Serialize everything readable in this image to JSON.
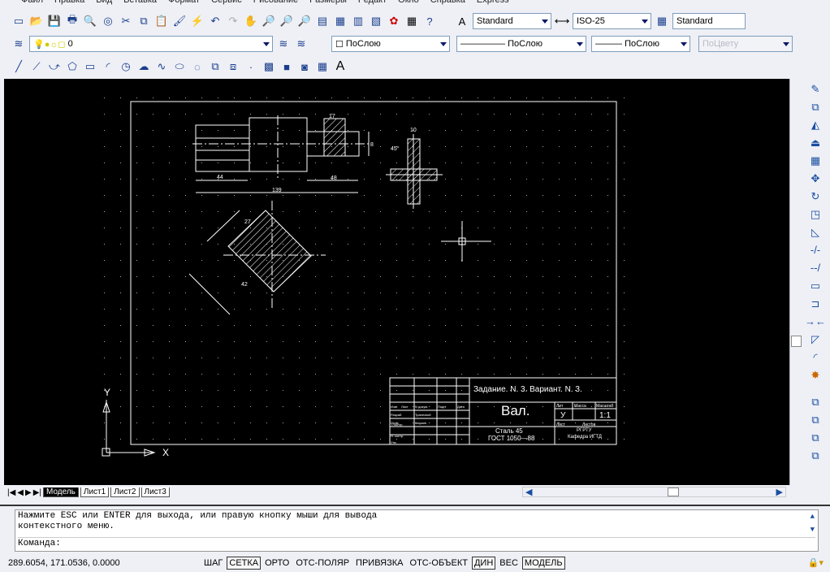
{
  "menu": [
    "Файл",
    "Правка",
    "Вид",
    "Вставка",
    "Формат",
    "Сервис",
    "Рисование",
    "Размеры",
    "Редакт",
    "Окно",
    "Справка",
    "Express"
  ],
  "styles": {
    "text_style": "Standard",
    "dim_style": "ISO-25",
    "table_style": "Standard"
  },
  "layers": {
    "current": "0",
    "color": "ПоСлою",
    "linetype": "ПоСлою",
    "lineweight": "ПоСлою",
    "plotstyle": "ПоЦвету"
  },
  "drawing": {
    "dims": [
      "44",
      "139",
      "48",
      "17",
      "8",
      "10",
      "45°",
      "27",
      "42"
    ],
    "title_block": {
      "task": "Задание. N. 3. Вариант. N. 3.",
      "name": "Вал.",
      "material": "Сталь 45",
      "standard": "ГОСТ  1050—88",
      "lit_label": "Лит",
      "mass_label": "Масса",
      "scale_label": "Масштаб",
      "lit": "У",
      "scale": "1:1",
      "sheet_label": "Лист",
      "sheets_label": "Листов",
      "org1": "РГРТУ",
      "org2": "Кафедра  ИГТД",
      "rows": [
        "Изм.",
        "Лист",
        "N докум.",
        "Подп.",
        "Дата",
        "Разраб.",
        "Трапезной",
        "Пров.",
        "Маркин",
        "Т. контр",
        "Н. контр.",
        "Утв."
      ]
    },
    "ucs": {
      "x": "X",
      "y": "Y"
    }
  },
  "tabs": [
    "Модель",
    "Лист1",
    "Лист2",
    "Лист3"
  ],
  "active_tab": "Модель",
  "command": {
    "line1": "Нажмите ESC или ENTER для выхода, или правую кнопку мыши для вывода",
    "line2": "контекстного меню.",
    "prompt": "Команда:"
  },
  "status": {
    "coords": "289.6054, 171.0536, 0.0000",
    "buttons": [
      {
        "label": "ШАГ",
        "on": false
      },
      {
        "label": "СЕТКА",
        "on": true
      },
      {
        "label": "ОРТО",
        "on": false
      },
      {
        "label": "ОТС-ПОЛЯР",
        "on": false
      },
      {
        "label": "ПРИВЯЗКА",
        "on": false
      },
      {
        "label": "ОТС-ОБЪЕКТ",
        "on": false
      },
      {
        "label": "ДИН",
        "on": true
      },
      {
        "label": "ВЕС",
        "on": false
      },
      {
        "label": "МОДЕЛЬ",
        "on": true
      }
    ]
  }
}
